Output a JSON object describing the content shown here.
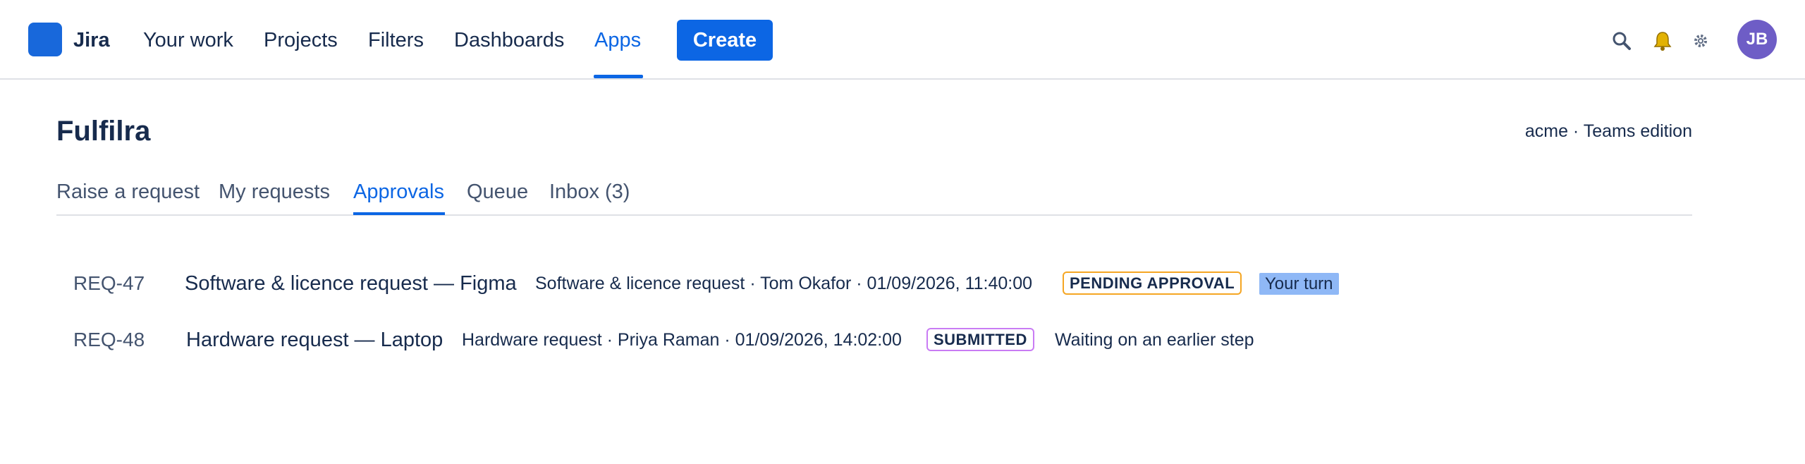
{
  "topnav": {
    "product": "Jira",
    "items": [
      {
        "label": "Your work"
      },
      {
        "label": "Projects"
      },
      {
        "label": "Filters"
      },
      {
        "label": "Dashboards"
      },
      {
        "label": "Apps",
        "active": true
      }
    ],
    "create_label": "Create",
    "icons": [
      "search-icon",
      "bell-icon",
      "gear-icon"
    ],
    "avatar_initials": "JB"
  },
  "page": {
    "title": "Fulfilra",
    "edition": "acme · Teams edition"
  },
  "tabs": [
    {
      "label": "Raise a request"
    },
    {
      "label": "My requests"
    },
    {
      "label": "Approvals",
      "active": true
    },
    {
      "label": "Queue"
    },
    {
      "label": "Inbox (3)"
    }
  ],
  "requests": [
    {
      "key": "REQ-47",
      "title": "Software & licence request — Figma",
      "meta": "Software & licence request · Tom Okafor · 01/09/2026, 11:40:00",
      "status": "PENDING APPROVAL",
      "note": "Your turn"
    },
    {
      "key": "REQ-48",
      "title": "Hardware request — Laptop",
      "meta": "Hardware request · Priya Raman · 01/09/2026, 14:02:00",
      "status": "SUBMITTED",
      "note": "Waiting on an earlier step"
    }
  ],
  "colors": {
    "accent": "#0c66e4",
    "pending_border": "#f5a623",
    "submitted_border": "#c97cf4",
    "turn_chip": "#8fb8f6",
    "avatar": "#6e5dc6"
  }
}
